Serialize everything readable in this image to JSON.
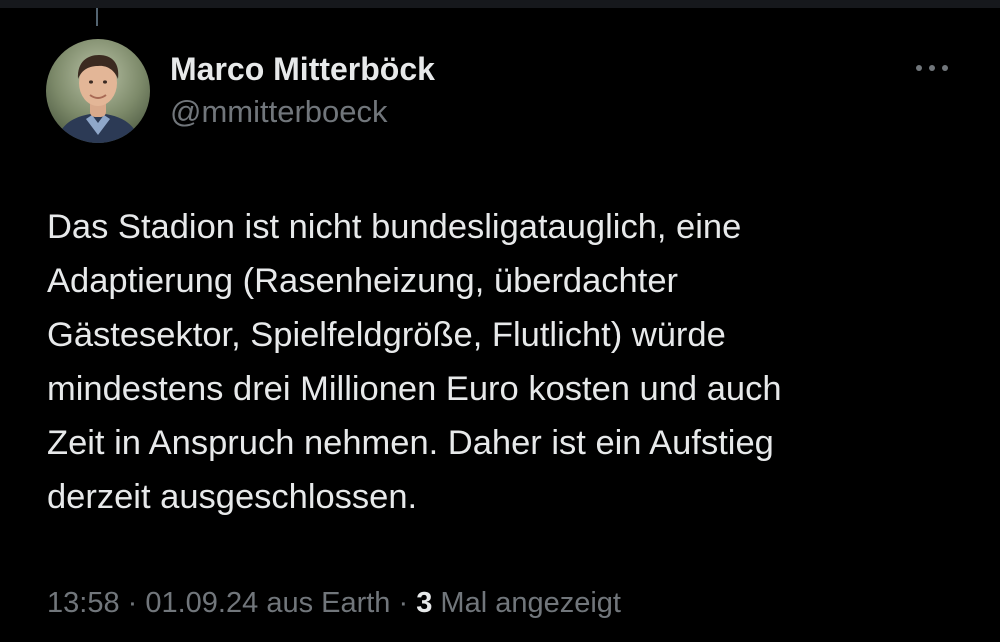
{
  "author": {
    "display_name": "Marco Mitterböck",
    "handle": "@mmitterboeck"
  },
  "tweet": {
    "text": "Das Stadion ist nicht bundesligatauglich, eine\nAdaptierung (Rasenheizung, überdachter\nGästesektor, Spielfeldgröße, Flutlicht) würde\nmindestens drei Millionen Euro kosten und auch\nZeit in Anspruch nehmen. Daher ist ein Aufstieg\nderzeit ausgeschlossen."
  },
  "meta": {
    "time": "13:58",
    "separator": " · ",
    "date": "01.09.24",
    "source": "aus Earth",
    "views_count": "3",
    "views_label": " Mal angezeigt"
  },
  "icons": {
    "more": "more-horizontal-icon"
  },
  "colors": {
    "background": "#000000",
    "primary_text": "#e7e9ea",
    "secondary_text": "#71767b"
  }
}
